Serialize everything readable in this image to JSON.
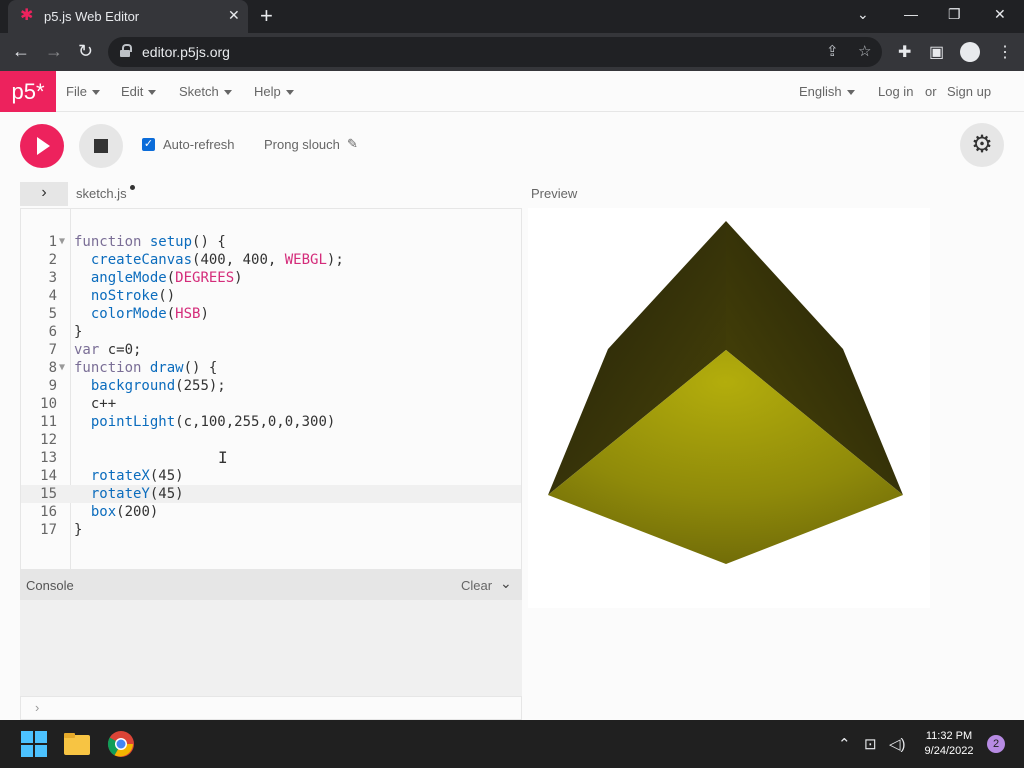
{
  "browser": {
    "tab_title": "p5.js Web Editor",
    "url": "editor.p5js.org"
  },
  "p5": {
    "logo": "p5*",
    "menus": [
      "File",
      "Edit",
      "Sketch",
      "Help"
    ],
    "language": "English",
    "login": "Log in",
    "or": "or",
    "signup": "Sign up",
    "auto_refresh_label": "Auto-refresh",
    "auto_refresh_checked": true,
    "sketch_name": "Prong slouch",
    "file_name": "sketch.js",
    "preview_label": "Preview",
    "console_label": "Console",
    "clear_label": "Clear"
  },
  "code": [
    {
      "n": "1",
      "text": "function setup() {",
      "fold": true
    },
    {
      "n": "2",
      "text": "  createCanvas(400, 400, WEBGL);"
    },
    {
      "n": "3",
      "text": "  angleMode(DEGREES)"
    },
    {
      "n": "4",
      "text": "  noStroke()"
    },
    {
      "n": "5",
      "text": "  colorMode(HSB)"
    },
    {
      "n": "6",
      "text": "}"
    },
    {
      "n": "7",
      "text": "var c=0;"
    },
    {
      "n": "8",
      "text": "function draw() {",
      "fold": true
    },
    {
      "n": "9",
      "text": "  background(255);"
    },
    {
      "n": "10",
      "text": "  c++"
    },
    {
      "n": "11",
      "text": "  pointLight(c,100,255,0,0,300)"
    },
    {
      "n": "12",
      "text": ""
    },
    {
      "n": "13",
      "text": ""
    },
    {
      "n": "14",
      "text": "  rotateX(45)"
    },
    {
      "n": "15",
      "text": "  rotateY(45)",
      "active": true
    },
    {
      "n": "16",
      "text": "  box(200)"
    },
    {
      "n": "17",
      "text": "}"
    }
  ],
  "taskbar": {
    "time": "11:32 PM",
    "date": "9/24/2022",
    "notifications": "2"
  },
  "colors": {
    "p5_pink": "#ed225d",
    "cube_dark": "#2e2a05",
    "cube_yellow": "#9e9a0b"
  }
}
